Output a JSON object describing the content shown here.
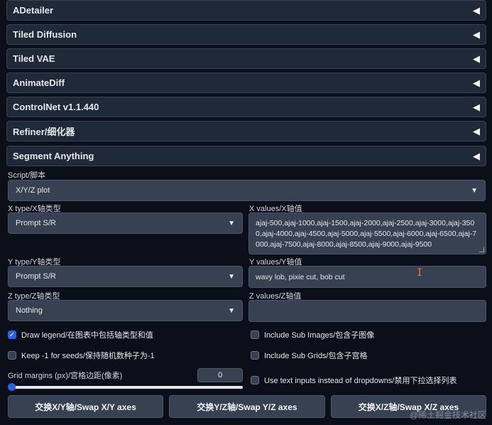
{
  "accordions": [
    {
      "label": "ADetailer"
    },
    {
      "label": "Tiled Diffusion"
    },
    {
      "label": "Tiled VAE"
    },
    {
      "label": "AnimateDiff"
    },
    {
      "label": "ControlNet v1.1.440"
    },
    {
      "label": "Refiner/细化器"
    },
    {
      "label": "Segment Anything"
    }
  ],
  "collapse_glyph": "◀",
  "script": {
    "label": "Script/脚本",
    "value": "X/Y/Z plot"
  },
  "x_type": {
    "label": "X type/X轴类型",
    "value": "Prompt S/R"
  },
  "x_values": {
    "label": "X values/X轴值",
    "value": "ajaj-500,ajaj-1000,ajaj-1500,ajaj-2000,ajaj-2500,ajaj-3000,ajaj-3500,ajaj-4000,ajaj-4500,ajaj-5000,ajaj-5500,ajaj-6000,ajaj-6500,ajaj-7000,ajaj-7500,ajaj-8000,ajaj-8500,ajaj-9000,ajaj-9500"
  },
  "y_type": {
    "label": "Y type/Y轴类型",
    "value": "Prompt S/R"
  },
  "y_values": {
    "label": "Y values/Y轴值",
    "value": "wavy lob, pixie cut, bob cut"
  },
  "z_type": {
    "label": "Z type/Z轴类型",
    "value": "Nothing"
  },
  "z_values": {
    "label": "Z values/Z轴值",
    "value": ""
  },
  "checkboxes": {
    "draw_legend": {
      "label": "Draw legend/在图表中包括轴类型和值",
      "checked": true
    },
    "keep_seeds": {
      "label": "Keep -1 for seeds/保持随机数种子为-1",
      "checked": false
    },
    "include_sub_images": {
      "label": "Include Sub Images/包含子图像",
      "checked": false
    },
    "include_sub_grids": {
      "label": "Include Sub Grids/包含子宫格",
      "checked": false
    },
    "text_inputs": {
      "label": "Use text inputs instead of dropdowns/禁用下拉选择列表",
      "checked": false
    }
  },
  "grid_margins": {
    "label": "Grid margins (px)/宫格边距(像素)",
    "value": "0"
  },
  "buttons": {
    "swap_xy": "交换X/Y轴/Swap X/Y axes",
    "swap_yz": "交换Y/Z轴/Swap Y/Z axes",
    "swap_xz": "交换X/Z轴/Swap X/Z axes"
  },
  "watermark": "@稀土掘金技术社区",
  "colors": {
    "accent": "#2563eb",
    "background": "#0b0f19",
    "panel": "#1f2937",
    "input": "#374151"
  }
}
